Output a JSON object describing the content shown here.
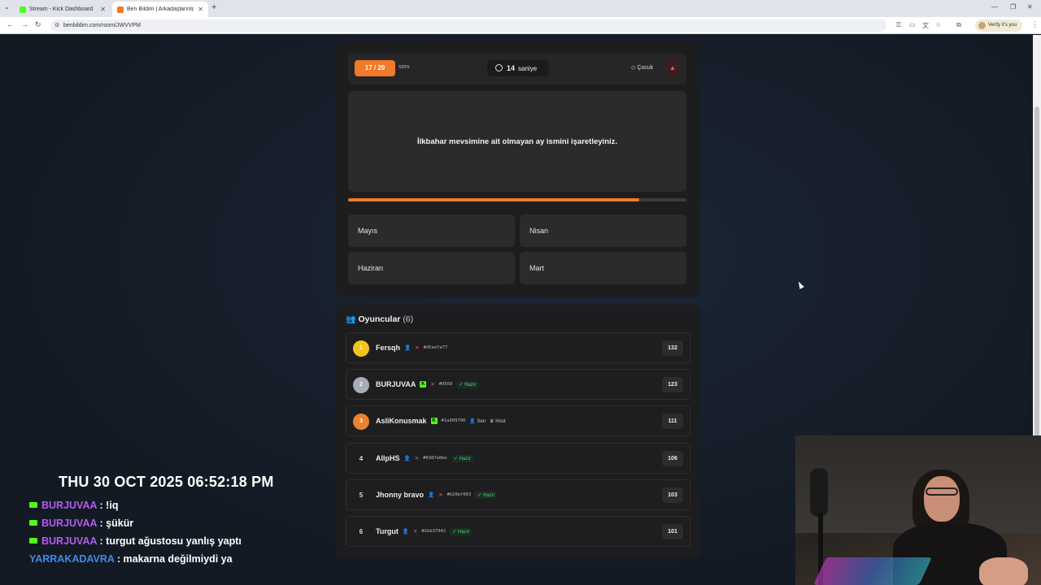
{
  "browser": {
    "tabs": [
      {
        "title": "Stream - Kick Dashboard",
        "active": false,
        "favicon_color": "#53fc18"
      },
      {
        "title": "Ben Bildim | Arkadaşlarınla Onl",
        "active": true,
        "favicon_color": "#f07a28"
      }
    ],
    "url": "benbildim.com/room/JWVVPM",
    "profile_label": "Verify it's you"
  },
  "game": {
    "counter": "17 / 20",
    "counter_label": "soru",
    "timer_value": "14",
    "timer_unit": "saniye",
    "category": "Çocuk",
    "question": "İlkbahar mevsimine ait olmayan ay ismini işaretleyiniz.",
    "time_progress_percent": 86,
    "answers": [
      "Mayıs",
      "Nisan",
      "Haziran",
      "Mart"
    ],
    "accent_color": "#f07a28"
  },
  "players": {
    "title": "Oyuncular",
    "count": "(6)",
    "list": [
      {
        "rank": "1",
        "name": "Fersqh",
        "hex": "#d5eefa77",
        "ready": "",
        "you": "",
        "host": "",
        "score": "132",
        "rank_color": "#f0c419"
      },
      {
        "rank": "2",
        "name": "BURJUVAA",
        "hex": "#9569",
        "ready": "Hazır",
        "you": "",
        "host": "",
        "score": "123",
        "rank_color": "#a8adb5"
      },
      {
        "rank": "3",
        "name": "AsliKonusmak",
        "hex": "#1a909700",
        "ready": "",
        "you": "Sen",
        "host": "Host",
        "score": "111",
        "rank_color": "#e9822f"
      },
      {
        "rank": "4",
        "name": "AllpHS",
        "hex": "#0387e8be",
        "ready": "Hazır",
        "you": "",
        "host": "",
        "score": "106",
        "rank_color": ""
      },
      {
        "rank": "5",
        "name": "Jhonny bravo",
        "hex": "#b20ef063",
        "ready": "Hazır",
        "you": "",
        "host": "",
        "score": "103",
        "rank_color": ""
      },
      {
        "rank": "6",
        "name": "Turgut",
        "hex": "#2bb37942",
        "ready": "Hazır",
        "you": "",
        "host": "",
        "score": "101",
        "rank_color": ""
      }
    ]
  },
  "overlay": {
    "datetime": "THU 30 OCT 2025 06:52:18 PM",
    "chat": [
      {
        "user": "BURJUVAA",
        "message": ": !iq",
        "badge": true
      },
      {
        "user": "BURJUVAA",
        "message": ": şükür",
        "badge": true
      },
      {
        "user": "BURJUVAA",
        "message": ": turgut ağustosu yanlış yaptı",
        "badge": true
      },
      {
        "user": "YARRAKADAVRA",
        "message": ": makarna değilmiydi ya",
        "badge": false
      }
    ]
  }
}
